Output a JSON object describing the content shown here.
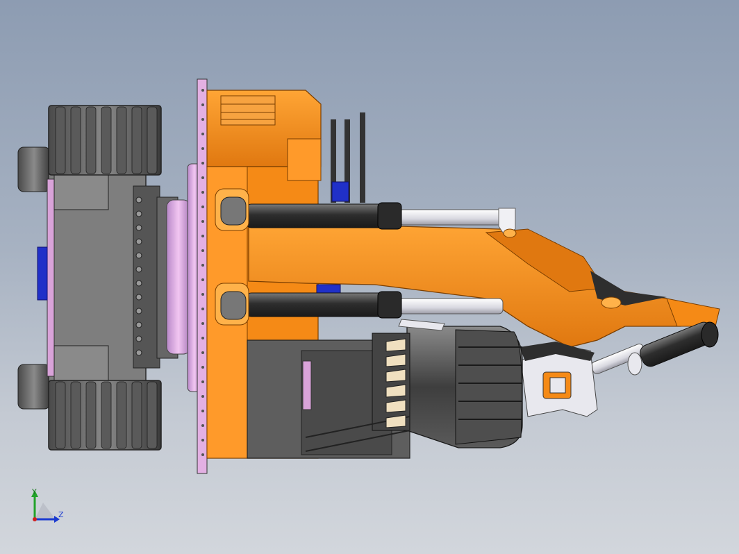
{
  "viewport": {
    "background_top": "#8d9cb2",
    "background_bottom": "#d2d6dc"
  },
  "colors": {
    "orange": "#f58a16",
    "orange_dark": "#c96a08",
    "orange_light": "#ffb24a",
    "gray": "#6b6b6b",
    "gray_dark": "#3f3f3f",
    "gray_light": "#9a9a9a",
    "pink": "#d9a3d9",
    "pink_light": "#f0c8f0",
    "blue": "#2030c8",
    "white_part": "#e8e8ee",
    "cylinder_dark": "#3a3a3a"
  },
  "triad": {
    "y_label": "Y",
    "z_label": "Z",
    "y_color": "#22a32a",
    "z_color": "#1a3ad0",
    "x_color": "#d02020"
  },
  "model": {
    "icon": "cad-3d-model-excavator-arm"
  }
}
